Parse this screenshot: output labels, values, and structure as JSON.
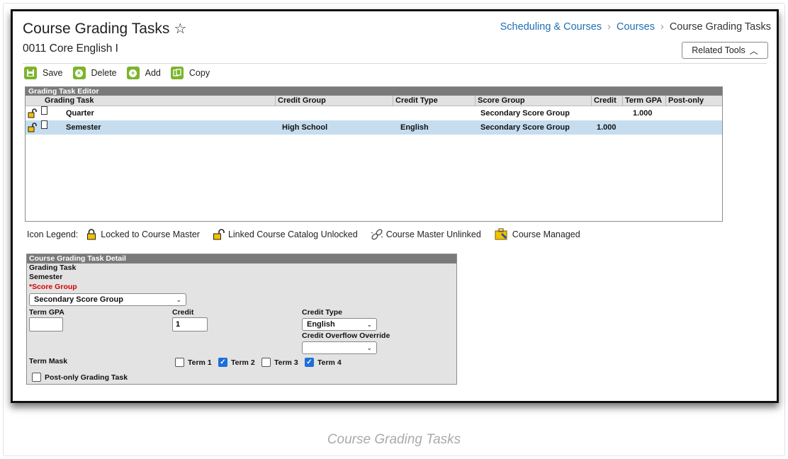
{
  "page": {
    "title": "Course Grading Tasks",
    "star_icon": "star-icon",
    "subtitle": "0011 Core English I",
    "breadcrumbs": [
      "Scheduling & Courses",
      "Courses",
      "Course Grading Tasks"
    ],
    "related_tools_label": "Related Tools",
    "caption": "Course Grading Tasks"
  },
  "toolbar": {
    "save_label": "Save",
    "delete_label": "Delete",
    "add_label": "Add",
    "copy_label": "Copy"
  },
  "editor": {
    "caption": "Grading Task Editor",
    "columns": [
      "Grading Task",
      "Credit Group",
      "Credit Type",
      "Score Group",
      "Credit",
      "Term GPA",
      "Post-only"
    ],
    "rows": [
      {
        "task": "Quarter",
        "credit_group": "",
        "credit_type": "",
        "score_group": "Secondary Score Group",
        "credit": "",
        "term_gpa": "1.000",
        "post_only": ""
      },
      {
        "task": "Semester",
        "credit_group": "High School",
        "credit_type": "English",
        "score_group": "Secondary Score Group",
        "credit": "1.000",
        "term_gpa": "",
        "post_only": ""
      }
    ],
    "selected_row": 1
  },
  "legend": {
    "label": "Icon Legend:",
    "items": [
      {
        "icon": "locked-icon",
        "text": "Locked to Course Master"
      },
      {
        "icon": "unlocked-icon",
        "text": "Linked Course Catalog Unlocked"
      },
      {
        "icon": "unlinked-icon",
        "text": "Course Master Unlinked"
      },
      {
        "icon": "managed-icon",
        "text": "Course Managed"
      }
    ]
  },
  "detail": {
    "caption": "Course Grading Task Detail",
    "grading_task_label": "Grading Task",
    "grading_task_value": "Semester",
    "score_group_label": "*Score Group",
    "score_group_value": "Secondary Score Group",
    "term_gpa_label": "Term GPA",
    "term_gpa_value": "",
    "credit_label": "Credit",
    "credit_value": "1",
    "credit_type_label": "Credit Type",
    "credit_type_value": "English",
    "credit_overflow_label": "Credit Overflow Override",
    "credit_overflow_value": "",
    "term_mask_label": "Term Mask",
    "terms": [
      {
        "label": "Term 1",
        "checked": false
      },
      {
        "label": "Term 2",
        "checked": true
      },
      {
        "label": "Term 3",
        "checked": false
      },
      {
        "label": "Term 4",
        "checked": true
      }
    ],
    "post_only_label": "Post-only Grading Task",
    "post_only_checked": false
  },
  "colors": {
    "toolbar_icon": "#7cb42c",
    "link": "#1f6fb2",
    "selected_row": "#c6ddf0",
    "required": "#d40000",
    "checkbox_on": "#1e6fd9"
  }
}
